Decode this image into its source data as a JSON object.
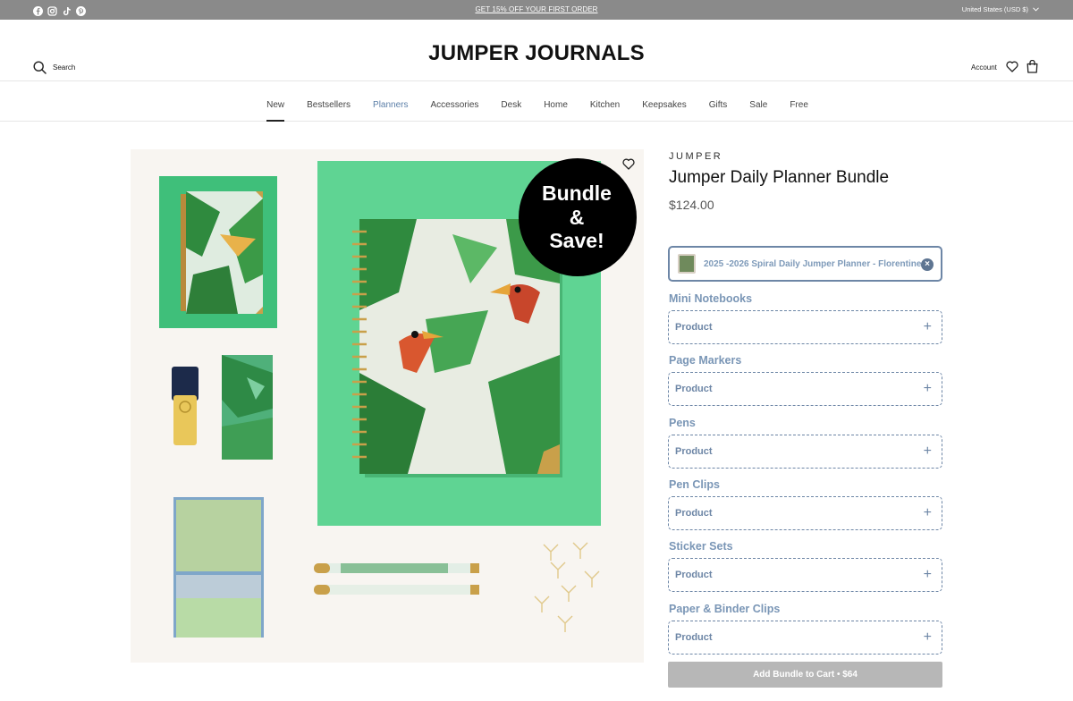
{
  "announcement": {
    "social_icons": [
      "facebook-icon",
      "instagram-icon",
      "tiktok-icon",
      "pinterest-icon"
    ],
    "promo": "GET 15% OFF YOUR FIRST ORDER",
    "currency": "United States (USD $)"
  },
  "header": {
    "search_label": "Search",
    "logo": "JUMPER JOURNALS",
    "account_label": "Account"
  },
  "nav": [
    {
      "label": "New"
    },
    {
      "label": "Bestsellers"
    },
    {
      "label": "Planners"
    },
    {
      "label": "Accessories"
    },
    {
      "label": "Desk"
    },
    {
      "label": "Home"
    },
    {
      "label": "Kitchen"
    },
    {
      "label": "Keepsakes"
    },
    {
      "label": "Gifts"
    },
    {
      "label": "Sale"
    },
    {
      "label": "Free"
    }
  ],
  "gallery": {
    "badge_line1": "Bundle",
    "badge_line2": "&",
    "badge_line3": "Save!"
  },
  "product": {
    "brand": "JUMPER",
    "title": "Jumper Daily Planner Bundle",
    "price": "$124.00",
    "selected_item": "2025 -2026 Spiral Daily Jumper Planner - Florentine",
    "remove_glyph": "×",
    "groups": [
      {
        "label": "Mini Notebooks",
        "placeholder": "Product"
      },
      {
        "label": "Page Markers",
        "placeholder": "Product"
      },
      {
        "label": "Pens",
        "placeholder": "Product"
      },
      {
        "label": "Pen Clips",
        "placeholder": "Product"
      },
      {
        "label": "Sticker Sets",
        "placeholder": "Product"
      },
      {
        "label": "Paper & Binder Clips",
        "placeholder": "Product"
      }
    ],
    "add_to_cart": "Add Bundle to Cart • $64"
  },
  "colors": {
    "accent": "#6d86a6",
    "label_blue": "#7a96b6",
    "topbar": "#8a8a8a",
    "button_disabled": "#b7b7b7"
  }
}
